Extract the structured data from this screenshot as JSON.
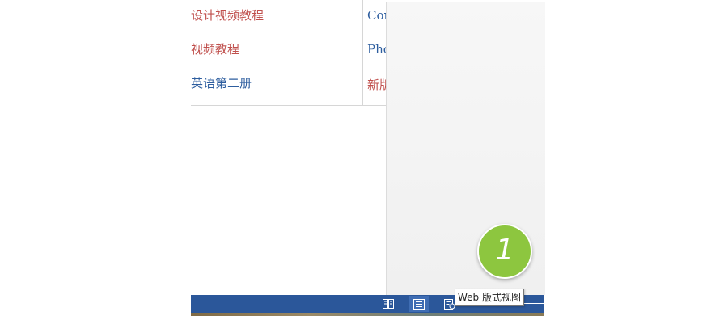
{
  "document": {
    "rows": [
      {
        "left": "设计视频教程",
        "right": "Cor"
      },
      {
        "left": "视频教程",
        "right": "Pho"
      },
      {
        "left": "英语第二册",
        "right": "新版"
      }
    ]
  },
  "badge": {
    "number": "1"
  },
  "statusbar": {
    "views": [
      {
        "name": "read-mode",
        "icon": "book-icon"
      },
      {
        "name": "print-layout",
        "icon": "page-icon"
      },
      {
        "name": "web-layout",
        "icon": "web-page-icon"
      }
    ],
    "tooltip": "Web 版式视图"
  },
  "colors": {
    "accent_red": "#c0504d",
    "link_blue": "#2e5e9f",
    "statusbar_blue": "#2b579a",
    "badge_green": "#8dc63f"
  }
}
